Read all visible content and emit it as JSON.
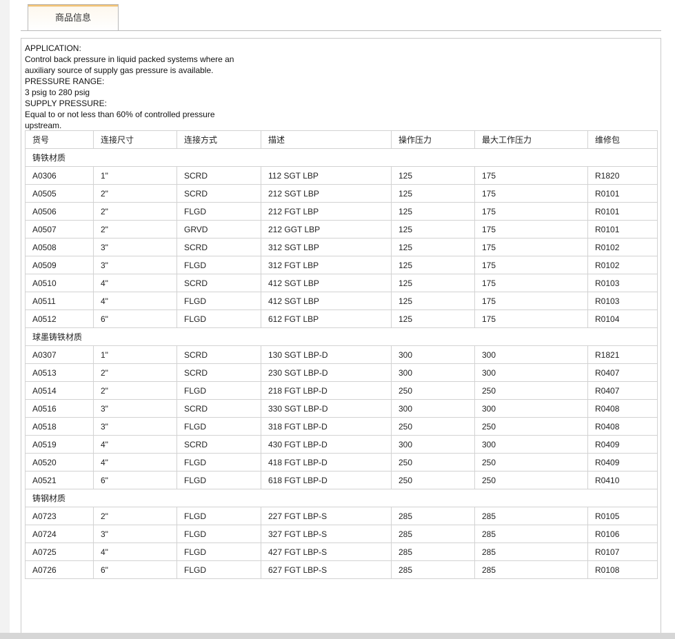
{
  "tabs": [
    {
      "label": "商品信息",
      "active": true
    }
  ],
  "description": {
    "lines": [
      "APPLICATION:",
      "Control back pressure in liquid packed systems where an",
      "auxiliary source of supply gas pressure is available.",
      "PRESSURE RANGE:",
      "3 psig to 280 psig",
      "SUPPLY PRESSURE:",
      "Equal to or not less than 60% of controlled pressure",
      "upstream."
    ]
  },
  "table": {
    "headers": [
      "货号",
      "连接尺寸",
      "连接方式",
      "描述",
      "操作压力",
      "最大工作压力",
      "维修包"
    ],
    "groups": [
      {
        "name": "铸铁材质",
        "rows": [
          [
            "A0306",
            "1\"",
            "SCRD",
            "112 SGT LBP",
            "125",
            "175",
            "R1820"
          ],
          [
            "A0505",
            "2\"",
            "SCRD",
            "212 SGT LBP",
            "125",
            "175",
            "R0101"
          ],
          [
            "A0506",
            "2\"",
            "FLGD",
            "212 FGT LBP",
            "125",
            "175",
            "R0101"
          ],
          [
            "A0507",
            "2\"",
            "GRVD",
            "212 GGT LBP",
            "125",
            "175",
            "R0101"
          ],
          [
            "A0508",
            "3\"",
            "SCRD",
            "312 SGT LBP",
            "125",
            "175",
            "R0102"
          ],
          [
            "A0509",
            "3\"",
            "FLGD",
            "312 FGT LBP",
            "125",
            "175",
            "R0102"
          ],
          [
            "A0510",
            "4\"",
            "SCRD",
            "412 SGT LBP",
            "125",
            "175",
            "R0103"
          ],
          [
            "A0511",
            "4\"",
            "FLGD",
            "412 SGT LBP",
            "125",
            "175",
            "R0103"
          ],
          [
            "A0512",
            "6\"",
            "FLGD",
            "612 FGT LBP",
            "125",
            "175",
            "R0104"
          ]
        ]
      },
      {
        "name": "球墨铸铁材质",
        "rows": [
          [
            "A0307",
            "1\"",
            "SCRD",
            "130 SGT LBP-D",
            "300",
            "300",
            "R1821"
          ],
          [
            "A0513",
            "2\"",
            "SCRD",
            "230 SGT LBP-D",
            "300",
            "300",
            "R0407"
          ],
          [
            "A0514",
            "2\"",
            "FLGD",
            "218 FGT LBP-D",
            "250",
            "250",
            "R0407"
          ],
          [
            "A0516",
            "3\"",
            "SCRD",
            "330 SGT LBP-D",
            "300",
            "300",
            "R0408"
          ],
          [
            "A0518",
            "3\"",
            "FLGD",
            "318 FGT LBP-D",
            "250",
            "250",
            "R0408"
          ],
          [
            "A0519",
            "4\"",
            "SCRD",
            "430 FGT LBP-D",
            "300",
            "300",
            "R0409"
          ],
          [
            "A0520",
            "4\"",
            "FLGD",
            "418 FGT LBP-D",
            "250",
            "250",
            "R0409"
          ],
          [
            "A0521",
            "6\"",
            "FLGD",
            "618 FGT LBP-D",
            "250",
            "250",
            "R0410"
          ]
        ]
      },
      {
        "name": "铸钢材质",
        "rows": [
          [
            "A0723",
            "2\"",
            "FLGD",
            "227 FGT LBP-S",
            "285",
            "285",
            "R0105"
          ],
          [
            "A0724",
            "3\"",
            "FLGD",
            "327 FGT LBP-S",
            "285",
            "285",
            "R0106"
          ],
          [
            "A0725",
            "4\"",
            "FLGD",
            "427 FGT LBP-S",
            "285",
            "285",
            "R0107"
          ],
          [
            "A0726",
            "6\"",
            "FLGD",
            "627 FGT LBP-S",
            "285",
            "285",
            "R0108"
          ]
        ]
      }
    ]
  },
  "colors": {
    "tab_accent": "#f0c275",
    "border": "#d2d2d2"
  }
}
